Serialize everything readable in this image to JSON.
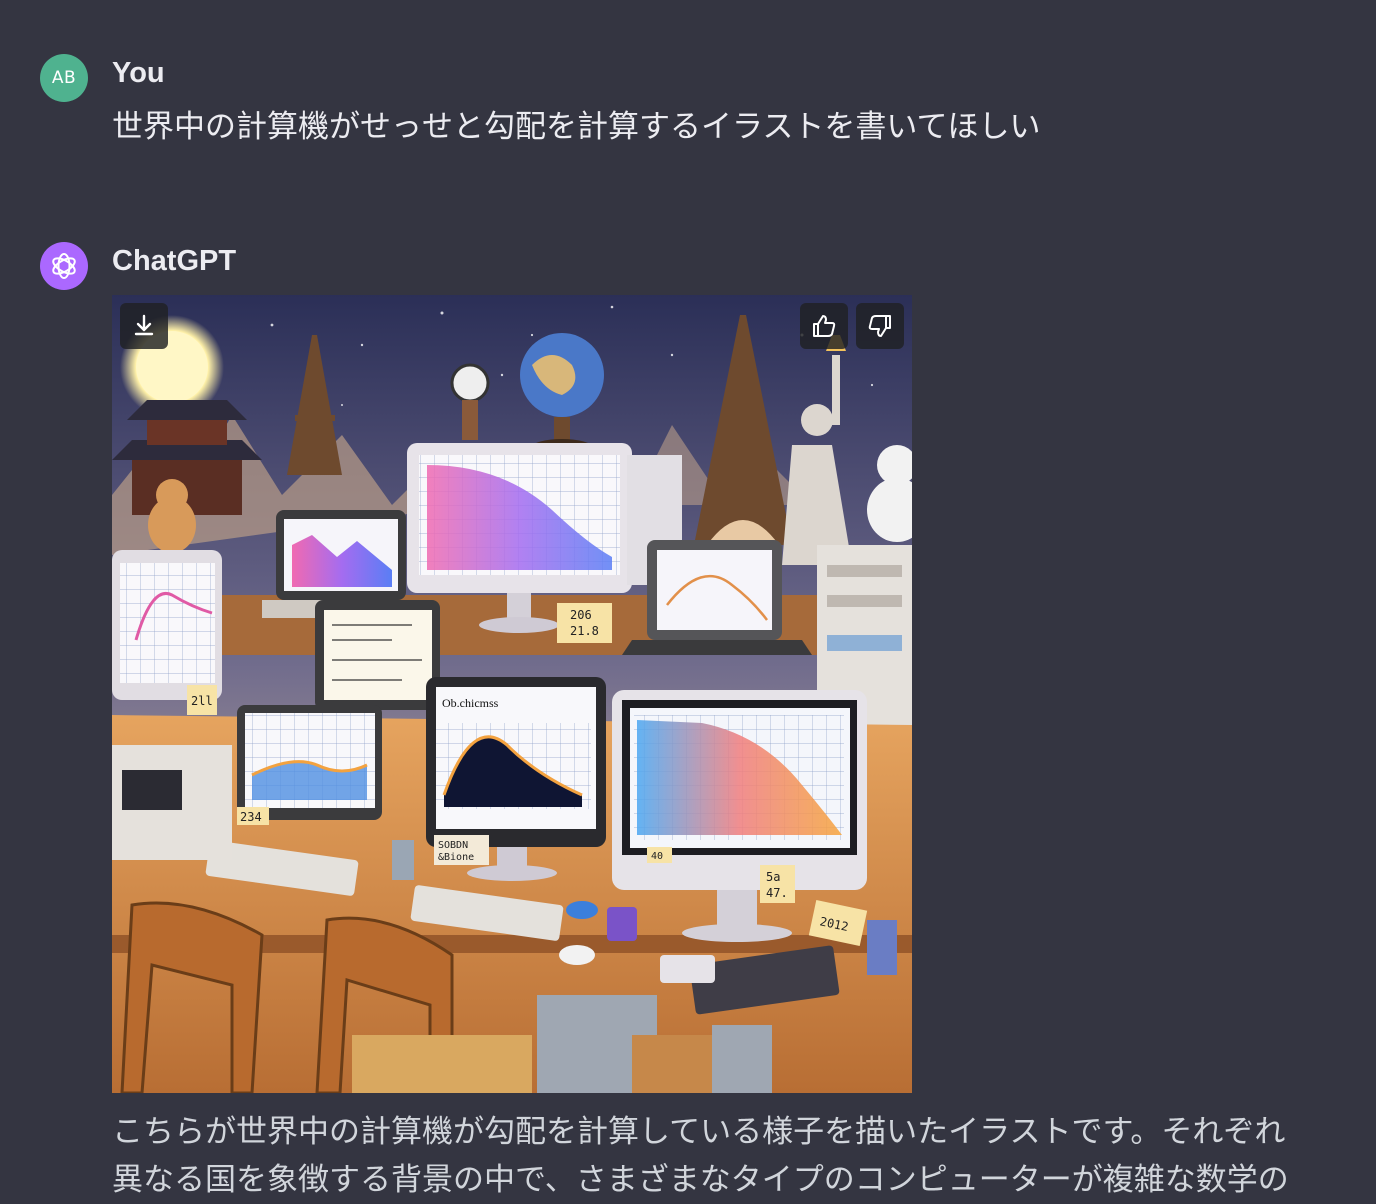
{
  "conversation": {
    "user": {
      "avatar_initials": "AB",
      "name": "You",
      "message": "世界中の計算機がせっせと勾配を計算するイラストを書いてほしい"
    },
    "assistant": {
      "name": "ChatGPT",
      "avatar_icon": "openai-logo-icon",
      "image": {
        "description_icons": [
          "download-icon",
          "thumbs-up-icon",
          "thumbs-down-icon"
        ]
      },
      "reply_line_1": "こちらが世界中の計算機が勾配を計算している様子を描いたイラストです。それぞれ",
      "reply_line_2": "異なる国を象徴する背景の中で、さまざまなタイプのコンピューターが複雑な数学の"
    }
  },
  "illustration_labels": {
    "monitor_title": "Ob.chicmss",
    "sticky_1": "206",
    "sticky_2": "21.8",
    "note_1": "5a",
    "note_2": "47.",
    "note_3": "40",
    "note_4": "234",
    "note_5": "2ll",
    "sign_1": "2012",
    "card_1": "SOBDN",
    "card_2": "&Bione"
  },
  "colors": {
    "background": "#343541",
    "user_avatar": "#4fb28f",
    "bot_avatar": "#ab68ff",
    "text": "#ececf1"
  }
}
